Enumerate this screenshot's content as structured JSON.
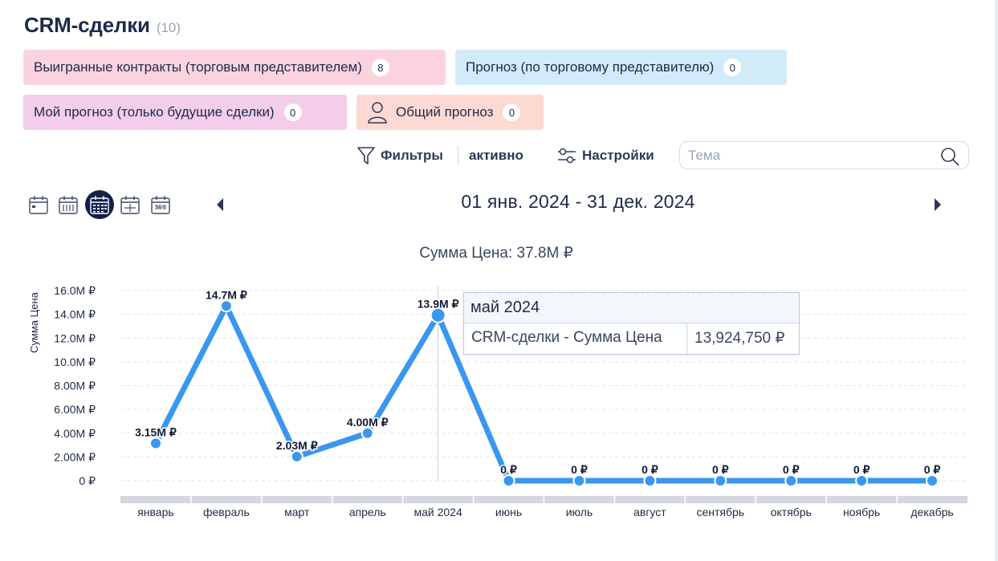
{
  "header": {
    "title": "CRM-сделки",
    "count": "(10)"
  },
  "chips": {
    "won": {
      "label": "Выигранные контракты (торговым представителем)",
      "count": "8"
    },
    "forecast": {
      "label": "Прогноз (по торговому представителю)",
      "count": "0"
    },
    "my_forecast": {
      "label": "Мой прогноз (только будущие сделки)",
      "count": "0"
    },
    "total_forecast": {
      "label": "Общий прогноз",
      "count": "0",
      "icon": "person-icon"
    }
  },
  "toolbar": {
    "filters_label": "Фильтры",
    "filters_state": "активно",
    "settings_label": "Настройки",
    "search_placeholder": "Тема"
  },
  "period": {
    "label": "01 янв. 2024 - 31 дек. 2024",
    "views": [
      "day-view-icon",
      "week-view-icon",
      "month-view-icon",
      "quarter-view-icon",
      "year-view-icon"
    ],
    "selected_view": "month-view-icon"
  },
  "chart_data": {
    "type": "line",
    "title": "Сумма Цена: 37.8M ₽",
    "ylabel": "Сумма Цена",
    "xlabel": "",
    "ylim": [
      0,
      16000000
    ],
    "yticks": [
      "0 ₽",
      "2.00M ₽",
      "4.00M ₽",
      "6.00M ₽",
      "8.00M ₽",
      "10.0M ₽",
      "12.0M ₽",
      "14.0M ₽",
      "16.0M ₽"
    ],
    "categories": [
      "январь",
      "февраль",
      "март",
      "апрель",
      "май 2024",
      "июнь",
      "июль",
      "август",
      "сентябрь",
      "октябрь",
      "ноябрь",
      "декабрь"
    ],
    "values": [
      3150000,
      14700000,
      2030000,
      4000000,
      13924750,
      0,
      0,
      0,
      0,
      0,
      0,
      0
    ],
    "data_labels": [
      "3.15M ₽",
      "14.7M ₽",
      "2.03M ₽",
      "4.00M ₽",
      "13.9M ₽",
      "0 ₽",
      "0 ₽",
      "0 ₽",
      "0 ₽",
      "0 ₽",
      "0 ₽",
      "0 ₽"
    ],
    "color": "#3a97f0",
    "grid": true,
    "legend": "none"
  },
  "tooltip": {
    "header": "май 2024",
    "series_label": "CRM-сделки - Сумма Цена",
    "value": "13,924,750 ₽"
  }
}
